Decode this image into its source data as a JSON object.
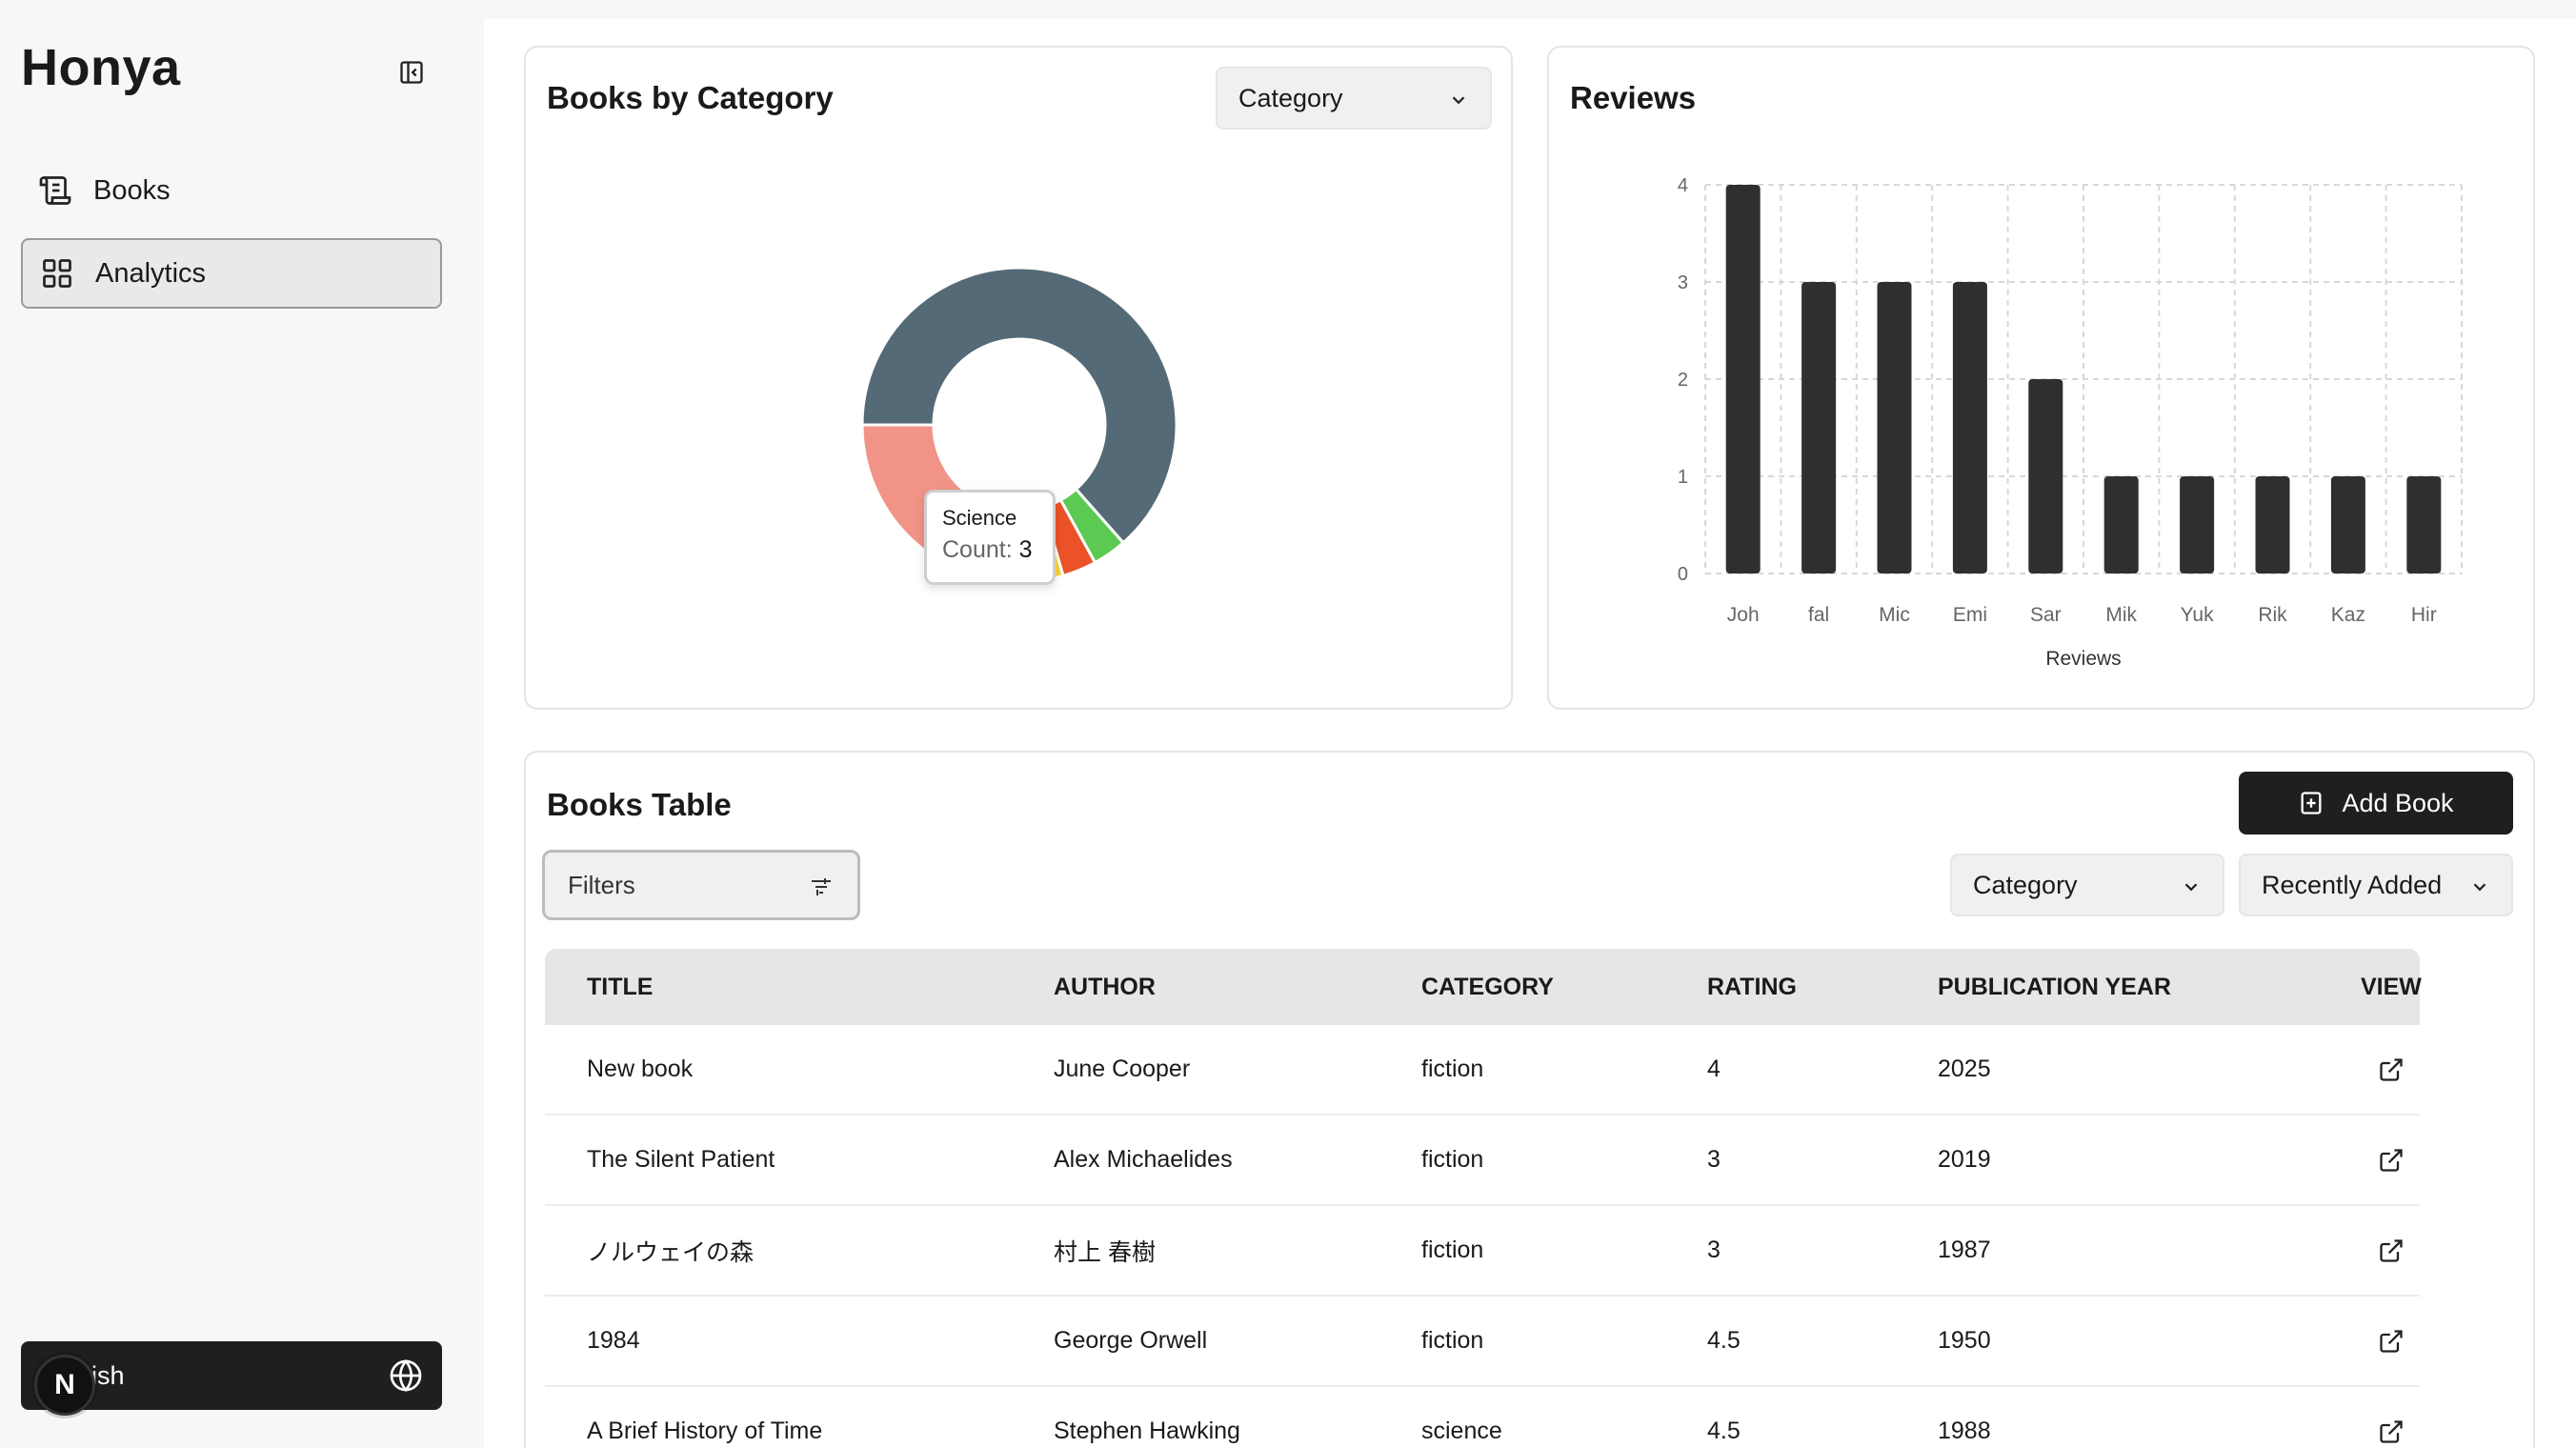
{
  "app": {
    "title": "Honya"
  },
  "sidebar": {
    "items": [
      {
        "label": "Books",
        "icon": "book-scroll-icon"
      },
      {
        "label": "Analytics",
        "icon": "dashboard-icon",
        "active": true
      }
    ],
    "language": {
      "label": "ish",
      "icon": "globe-icon"
    },
    "badge": "N"
  },
  "donut_card": {
    "title": "Books by Category",
    "select_value": "Category",
    "tooltip": {
      "name": "Science",
      "count_label": "Count:",
      "count_value": "3"
    }
  },
  "reviews_card": {
    "title": "Reviews"
  },
  "chart_data": {
    "type": "bar",
    "categories": [
      "Joh",
      "fal",
      "Mic",
      "Emi",
      "Sar",
      "Mik",
      "Yuk",
      "Rik",
      "Kaz",
      "Hir"
    ],
    "values": [
      4,
      3,
      3,
      3,
      2,
      1,
      1,
      1,
      1,
      1
    ],
    "xlabel": "Reviews",
    "ylabel": "",
    "ylim": [
      0,
      4
    ],
    "yticks": [
      0,
      1,
      2,
      3,
      4
    ],
    "grid": true,
    "color": "#2f2f2f"
  },
  "donut_data": {
    "type": "pie",
    "slices": [
      {
        "value": 63.5,
        "color": "#546a76"
      },
      {
        "value": 3.5,
        "color": "#5cc953"
      },
      {
        "value": 3.5,
        "color": "#ec5228"
      },
      {
        "value": 4.5,
        "color": "#f9d53e"
      },
      {
        "value": 5,
        "color": "#5f9e70"
      },
      {
        "value": 4,
        "color": "#9fc8ec"
      },
      {
        "value": 1,
        "color": "#4a7a2c"
      },
      {
        "value": 15,
        "color": "#f19487"
      }
    ]
  },
  "table_card": {
    "title": "Books Table",
    "add_label": "Add Book",
    "filters_label": "Filters",
    "category_select": "Category",
    "sort_select": "Recently Added",
    "columns": [
      "TITLE",
      "AUTHOR",
      "CATEGORY",
      "RATING",
      "PUBLICATION YEAR",
      "VIEW"
    ],
    "rows": [
      [
        "New book",
        "June Cooper",
        "fiction",
        "4",
        "2025"
      ],
      [
        "The Silent Patient",
        "Alex Michaelides",
        "fiction",
        "3",
        "2019"
      ],
      [
        "ノルウェイの森",
        "村上 春樹",
        "fiction",
        "3",
        "1987"
      ],
      [
        "1984",
        "George Orwell",
        "fiction",
        "4.5",
        "1950"
      ],
      [
        "A Brief History of Time",
        "Stephen Hawking",
        "science",
        "4.5",
        "1988"
      ]
    ]
  }
}
